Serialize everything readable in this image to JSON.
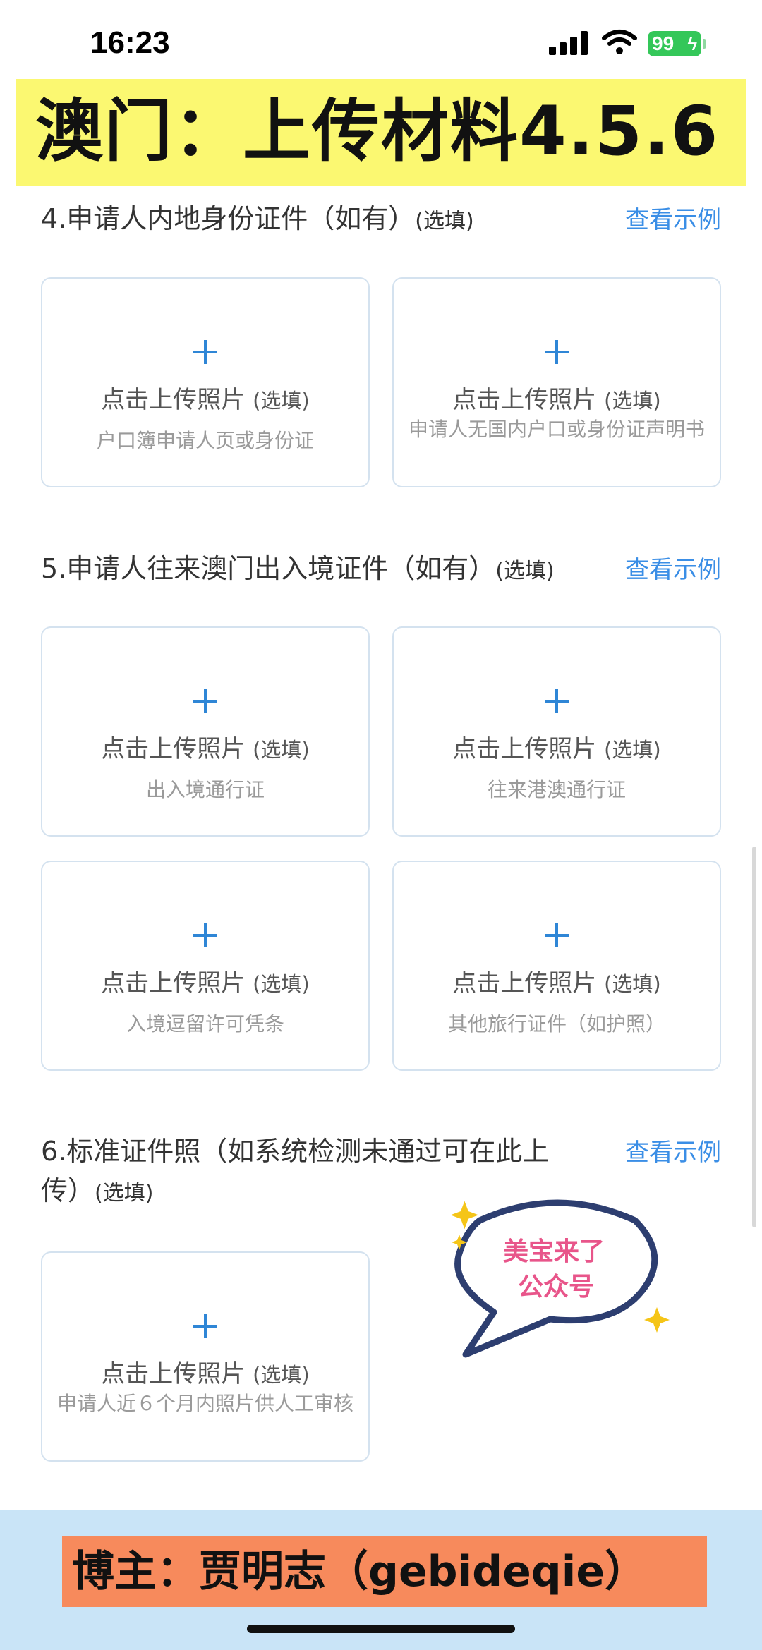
{
  "status_bar": {
    "time": "16:23",
    "battery": "99",
    "signal_icon": "signal-bars-icon",
    "wifi_icon": "wifi-icon"
  },
  "banner": {
    "title": "澳门：上传材料4.5.6"
  },
  "sections": [
    {
      "title": "4.申请人内地身份证件（如有）",
      "optional": "(选填)",
      "example_link": "查看示例",
      "cards": [
        {
          "cta": "点击上传照片",
          "optional": "(选填)",
          "hint": "户口簿申请人页或身份证"
        },
        {
          "cta": "点击上传照片",
          "optional": "(选填)",
          "hint": "申请人无国内户口或身份证声明书"
        }
      ]
    },
    {
      "title": "5.申请人往来澳门出入境证件（如有）",
      "optional": "(选填)",
      "example_link": "查看示例",
      "cards": [
        {
          "cta": "点击上传照片",
          "optional": "(选填)",
          "hint": "出入境通行证"
        },
        {
          "cta": "点击上传照片",
          "optional": "(选填)",
          "hint": "往来港澳通行证"
        },
        {
          "cta": "点击上传照片",
          "optional": "(选填)",
          "hint": "入境逗留许可凭条"
        },
        {
          "cta": "点击上传照片",
          "optional": "(选填)",
          "hint": "其他旅行证件（如护照）"
        }
      ]
    },
    {
      "title_line1": "6.标准证件照（如系统检测未通过可在此上",
      "title_line2": "传）",
      "optional": "(选填)",
      "example_link": "查看示例",
      "cards": [
        {
          "cta": "点击上传照片",
          "optional": "(选填)",
          "hint": "申请人近６个月内照片供人工审核"
        }
      ]
    }
  ],
  "watermark": {
    "line1": "美宝来了",
    "line2": "公众号"
  },
  "footer": {
    "label": "博主：贾明志（gebideqie）"
  },
  "colors": {
    "link": "#3a8ee6",
    "plus": "#2f86d6",
    "banner": "#fbf871",
    "footer_bg": "#c9e4f7",
    "footer_label": "#f78a5c"
  }
}
